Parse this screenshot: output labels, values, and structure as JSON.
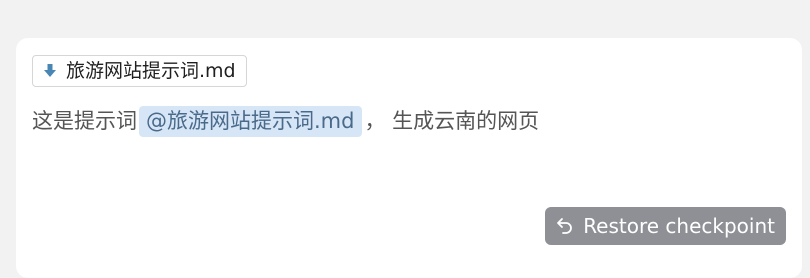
{
  "attachment": {
    "icon": "download-arrow-icon",
    "icon_color": "#4a86b4",
    "filename": "旅游网站提示词.md"
  },
  "message": {
    "prefix": "这是提示词",
    "mention": "@旅游网站提示词.md",
    "suffix": "， 生成云南的网页"
  },
  "restore": {
    "icon": "undo-arrow-icon",
    "label": "Restore checkpoint",
    "bg_color": "#8e9095"
  }
}
